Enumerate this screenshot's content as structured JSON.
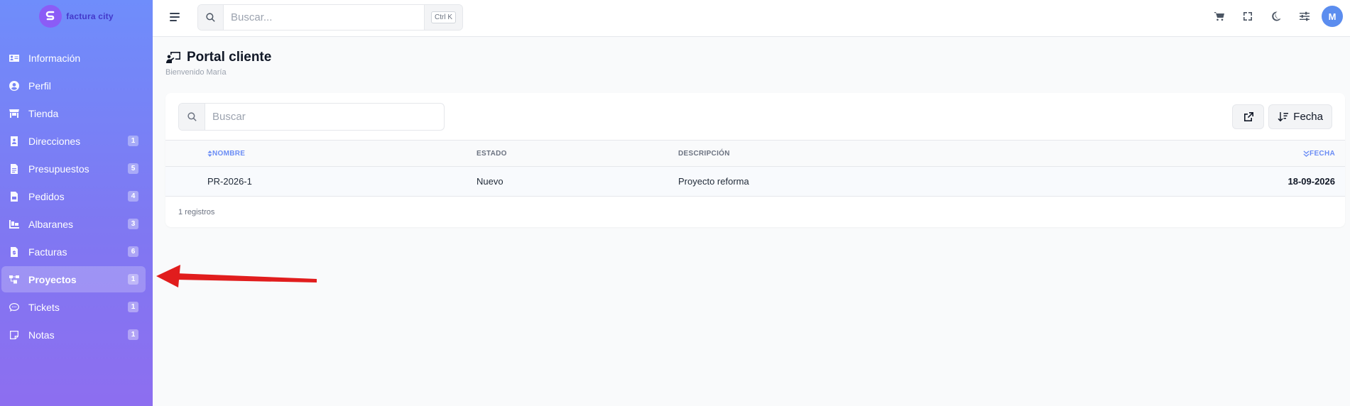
{
  "brand": {
    "name": "factura city"
  },
  "sidebar": {
    "items": [
      {
        "label": "Información",
        "icon": "id-card-icon",
        "badge": ""
      },
      {
        "label": "Perfil",
        "icon": "user-circle-icon",
        "badge": ""
      },
      {
        "label": "Tienda",
        "icon": "store-icon",
        "badge": ""
      },
      {
        "label": "Direcciones",
        "icon": "address-book-icon",
        "badge": "1"
      },
      {
        "label": "Presupuestos",
        "icon": "file-text-icon",
        "badge": "5"
      },
      {
        "label": "Pedidos",
        "icon": "file-invoice-icon",
        "badge": "4"
      },
      {
        "label": "Albaranes",
        "icon": "dolly-icon",
        "badge": "3"
      },
      {
        "label": "Facturas",
        "icon": "file-dollar-icon",
        "badge": "6"
      },
      {
        "label": "Proyectos",
        "icon": "project-diagram-icon",
        "badge": "1",
        "active": true
      },
      {
        "label": "Tickets",
        "icon": "comment-dots-icon",
        "badge": "1"
      },
      {
        "label": "Notas",
        "icon": "sticky-note-icon",
        "badge": "1"
      }
    ]
  },
  "topbar": {
    "search_placeholder": "Buscar...",
    "shortcut": "Ctrl K",
    "avatar_initial": "M"
  },
  "page": {
    "title": "Portal cliente",
    "subtitle": "Bienvenido María"
  },
  "table": {
    "search_placeholder": "Buscar",
    "sort_button_label": "Fecha",
    "columns": {
      "nombre": "NOMBRE",
      "estado": "ESTADO",
      "descripcion": "DESCRIPCIÓN",
      "fecha": "FECHA"
    },
    "rows": [
      {
        "nombre": "PR-2026-1",
        "estado": "Nuevo",
        "descripcion": "Proyecto reforma",
        "fecha": "18-09-2026"
      }
    ],
    "footer": "1 registros"
  },
  "colors": {
    "accent": "#6b8df5",
    "annotation_arrow": "#e11d1d"
  }
}
